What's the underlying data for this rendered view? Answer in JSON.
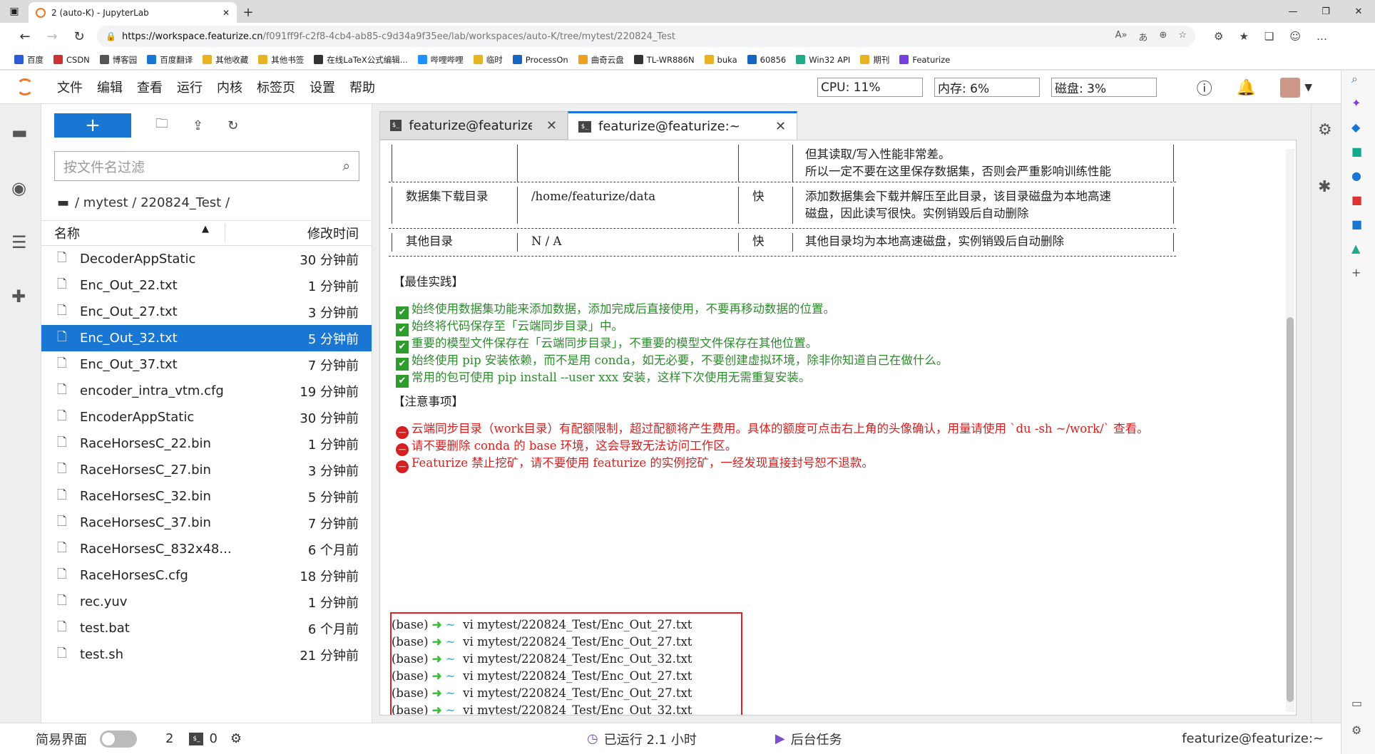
{
  "browser": {
    "tab_title": "2 (auto-K) - JupyterLab",
    "url_host": "https://workspace.featurize.cn",
    "url_path": "/f091ff9f-c2f8-4cb4-ab85-c9d34a9f35ee/lab/workspaces/auto-K/tree/mytest/220824_Test",
    "bookmarks": [
      "百度",
      "CSDN",
      "博客园",
      "百度翻译",
      "其他收藏",
      "其他书签",
      "在线LaTeX公式编辑...",
      "哔哩哔哩",
      "临时",
      "ProcessOn",
      "曲奇云盘",
      "TL-WR886N",
      "buka",
      "60856",
      "Win32 API",
      "期刊",
      "Featurize"
    ]
  },
  "menu": {
    "items": [
      "文件",
      "编辑",
      "查看",
      "运行",
      "内核",
      "标签页",
      "设置",
      "帮助"
    ],
    "cpu": "CPU: 11%",
    "mem": "内存: 6%",
    "disk": "磁盘: 3%"
  },
  "filebrowser": {
    "filter_placeholder": "按文件名过滤",
    "breadcrumb": "/ mytest / 220824_Test /",
    "col_name": "名称",
    "col_modified": "修改时间",
    "files": [
      {
        "name": "DecoderAppStatic",
        "time": "30 分钟前"
      },
      {
        "name": "Enc_Out_22.txt",
        "time": "1 分钟前"
      },
      {
        "name": "Enc_Out_27.txt",
        "time": "3 分钟前"
      },
      {
        "name": "Enc_Out_32.txt",
        "time": "5 分钟前"
      },
      {
        "name": "Enc_Out_37.txt",
        "time": "7 分钟前"
      },
      {
        "name": "encoder_intra_vtm.cfg",
        "time": "19 分钟前"
      },
      {
        "name": "EncoderAppStatic",
        "time": "30 分钟前"
      },
      {
        "name": "RaceHorsesC_22.bin",
        "time": "1 分钟前"
      },
      {
        "name": "RaceHorsesC_27.bin",
        "time": "3 分钟前"
      },
      {
        "name": "RaceHorsesC_32.bin",
        "time": "5 分钟前"
      },
      {
        "name": "RaceHorsesC_37.bin",
        "time": "7 分钟前"
      },
      {
        "name": "RaceHorsesC_832x48...",
        "time": "6 个月前"
      },
      {
        "name": "RaceHorsesC.cfg",
        "time": "18 分钟前"
      },
      {
        "name": "rec.yuv",
        "time": "1 分钟前"
      },
      {
        "name": "test.bat",
        "time": "6 个月前"
      },
      {
        "name": "test.sh",
        "time": "21 分钟前"
      }
    ]
  },
  "tabs": {
    "tab1": "featurize@featurize:~/mytes",
    "tab2": "featurize@featurize:~"
  },
  "terminal": {
    "row0": {
      "c4a": "但其读取/写入性能非常差。",
      "c4b": "所以一定不要在这里保存数据集，否则会严重影响训练性能"
    },
    "row1": {
      "c1": "数据集下载目录",
      "c2": "/home/featurize/data",
      "c3": "快",
      "c4a": "添加数据集会下载并解压至此目录，该目录磁盘为本地高速",
      "c4b": "磁盘，因此读写很快。实例销毁后自动删除"
    },
    "row2": {
      "c1": "其他目录",
      "c2": "N / A",
      "c3": "快",
      "c4a": "其他目录均为本地高速磁盘，实例销毁后自动删除"
    },
    "best_heading": "【最佳实践】",
    "best": [
      "始终使用数据集功能来添加数据，添加完成后直接使用，不要再移动数据的位置。",
      "始终将代码保存至「云端同步目录」中。",
      "重要的模型文件保存在「云端同步目录」，不重要的模型文件保存在其他位置。",
      "始终使用 pip 安装依赖，而不是用 conda，如无必要，不要创建虚拟环境，除非你知道自己在做什么。",
      "常用的包可使用 pip install --user xxx 安装，这样下次使用无需重复安装。"
    ],
    "notice_heading": "【注意事项】",
    "notices": [
      "云端同步目录（work目录）有配额限制，超过配额将产生费用。具体的额度可点击右上角的头像确认，用量请使用 `du -sh ~/work/` 查看。",
      "请不要删除 conda 的 base 环境，这会导致无法访问工作区。",
      "Featurize 禁止挖矿，请不要使用 featurize 的实例挖矿，一经发现直接封号恕不退款。"
    ],
    "prompt_prefix": "(base)",
    "prompt_dir": "~",
    "commands": [
      "vi mytest/220824_Test/Enc_Out_27.txt",
      "vi mytest/220824_Test/Enc_Out_27.txt",
      "vi mytest/220824_Test/Enc_Out_32.txt",
      "vi mytest/220824_Test/Enc_Out_27.txt",
      "vi mytest/220824_Test/Enc_Out_27.txt",
      "vi mytest/220824_Test/Enc_Out_32.txt",
      ""
    ]
  },
  "status": {
    "simple_mode": "简易界面",
    "kernels": "2",
    "terminals": "0",
    "uptime": "已运行 2.1 小时",
    "background": "后台任务",
    "user": "featurize@featurize:~"
  }
}
